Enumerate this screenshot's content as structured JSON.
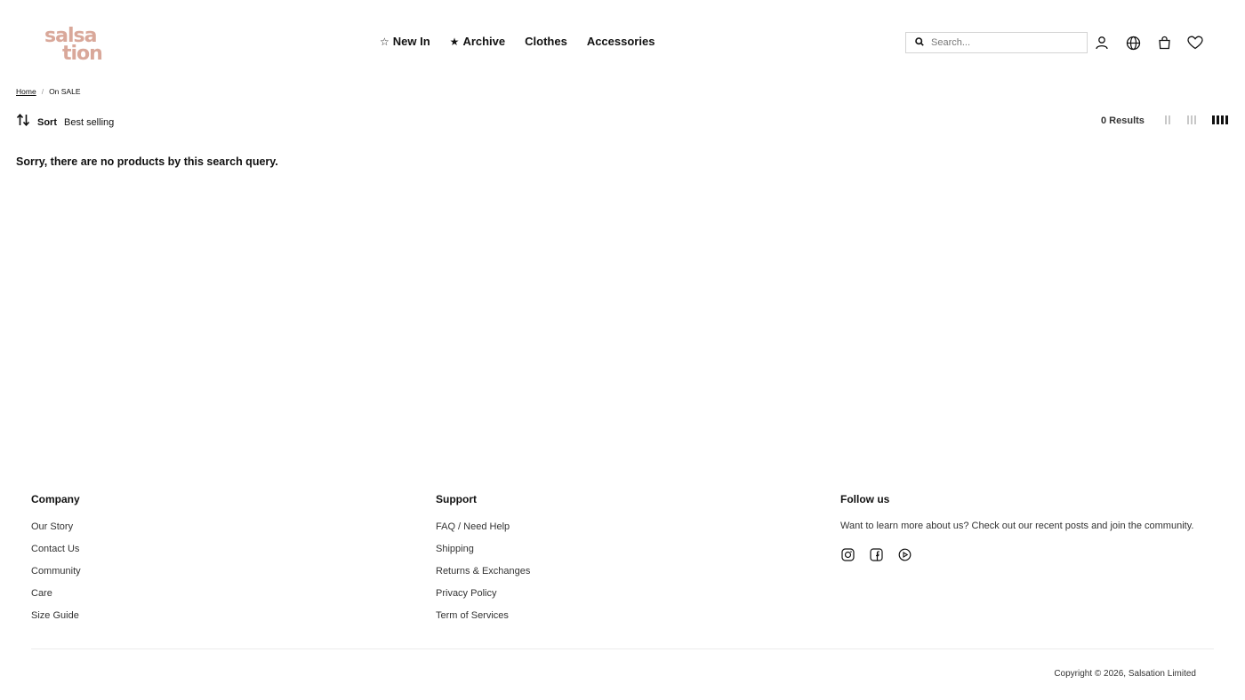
{
  "brand": {
    "logo_name": "salsation",
    "logo_line1": "salsa",
    "logo_line2": "tion",
    "logo_color": "#d9a89a"
  },
  "nav": {
    "items": [
      {
        "label": "New In",
        "icon": "star-outline-icon"
      },
      {
        "label": "Archive",
        "icon": "star-filled-icon"
      },
      {
        "label": "Clothes"
      },
      {
        "label": "Accessories"
      }
    ]
  },
  "search": {
    "placeholder": "Search..."
  },
  "header_icons": [
    "account-icon",
    "globe-icon",
    "bag-icon",
    "heart-icon"
  ],
  "breadcrumb": {
    "home": "Home",
    "separator": "/",
    "current": "On SALE"
  },
  "toolbar": {
    "sort_label": "Sort",
    "sort_value": "Best selling",
    "results": "0 Results",
    "grid_options": [
      "2-columns",
      "3-columns",
      "4-columns"
    ],
    "active_grid": "4-columns"
  },
  "main": {
    "empty_message": "Sorry, there are no products by this search query."
  },
  "footer": {
    "company": {
      "title": "Company",
      "links": [
        "Our Story",
        "Contact Us",
        "Community",
        "Care",
        "Size Guide"
      ]
    },
    "support": {
      "title": "Support",
      "links": [
        "FAQ / Need Help",
        "Shipping",
        "Returns & Exchanges",
        "Privacy Policy",
        "Term of Services"
      ]
    },
    "follow": {
      "title": "Follow us",
      "text": "Want to learn more about us? Check out our recent posts and join the community.",
      "socials": [
        "instagram-icon",
        "facebook-icon",
        "youtube-icon"
      ]
    },
    "copyright": "Copyright © 2026, Salsation Limited"
  }
}
